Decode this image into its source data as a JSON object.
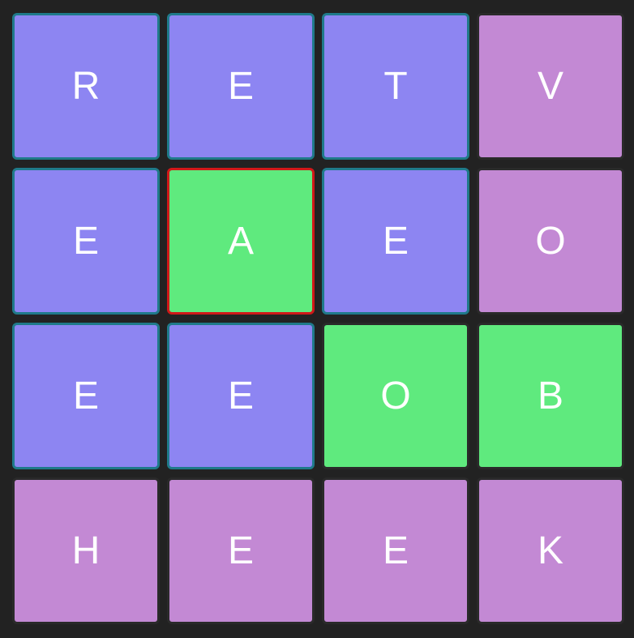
{
  "colors": {
    "background": "#222222",
    "blue": "#8d85f2",
    "green": "#5fea7e",
    "purple": "#c389d4",
    "teal_border": "#1f7a8a",
    "red_border": "#d01818",
    "dark_border": "#2a2a2a"
  },
  "grid": {
    "rows": [
      [
        {
          "letter": "R",
          "color": "blue",
          "border": "teal"
        },
        {
          "letter": "E",
          "color": "blue",
          "border": "teal"
        },
        {
          "letter": "T",
          "color": "blue",
          "border": "teal"
        },
        {
          "letter": "V",
          "color": "purple",
          "border": "dark"
        }
      ],
      [
        {
          "letter": "E",
          "color": "blue",
          "border": "teal"
        },
        {
          "letter": "A",
          "color": "green",
          "border": "red"
        },
        {
          "letter": "E",
          "color": "blue",
          "border": "teal"
        },
        {
          "letter": "O",
          "color": "purple",
          "border": "dark"
        }
      ],
      [
        {
          "letter": "E",
          "color": "blue",
          "border": "teal"
        },
        {
          "letter": "E",
          "color": "blue",
          "border": "teal"
        },
        {
          "letter": "O",
          "color": "green",
          "border": "dark"
        },
        {
          "letter": "B",
          "color": "green",
          "border": "dark"
        }
      ],
      [
        {
          "letter": "H",
          "color": "purple",
          "border": "dark"
        },
        {
          "letter": "E",
          "color": "purple",
          "border": "dark"
        },
        {
          "letter": "E",
          "color": "purple",
          "border": "dark"
        },
        {
          "letter": "K",
          "color": "purple",
          "border": "dark"
        }
      ]
    ]
  }
}
